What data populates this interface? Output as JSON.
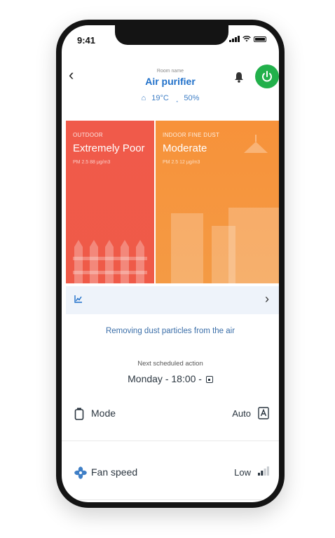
{
  "status_bar": {
    "time": "9:41"
  },
  "header": {
    "room_name": "Room name",
    "title": "Air purifier",
    "temperature": "19°C",
    "humidity": "50%"
  },
  "outdoor": {
    "label": "OUTDOOR",
    "status": "Extremely Poor",
    "detail": "PM 2.5 88 μg/m3"
  },
  "indoor": {
    "label": "INDOOR FINE DUST",
    "status": "Moderate",
    "detail": "PM 2.5 12 μg/m3"
  },
  "status_message": "Removing dust particles from the air",
  "schedule": {
    "label": "Next scheduled action",
    "value": "Monday - 18:00 -"
  },
  "mode": {
    "label": "Mode",
    "value": "Auto",
    "icon": "auto-mode-icon"
  },
  "fan": {
    "label": "Fan speed",
    "value": "Low",
    "icon": "fan-icon"
  },
  "colors": {
    "accent": "#1e6fc9",
    "power": "#22b04b",
    "outdoor_card": "#ef5a48",
    "indoor_card": "#f49a44",
    "history_strip": "#eef3fa"
  }
}
